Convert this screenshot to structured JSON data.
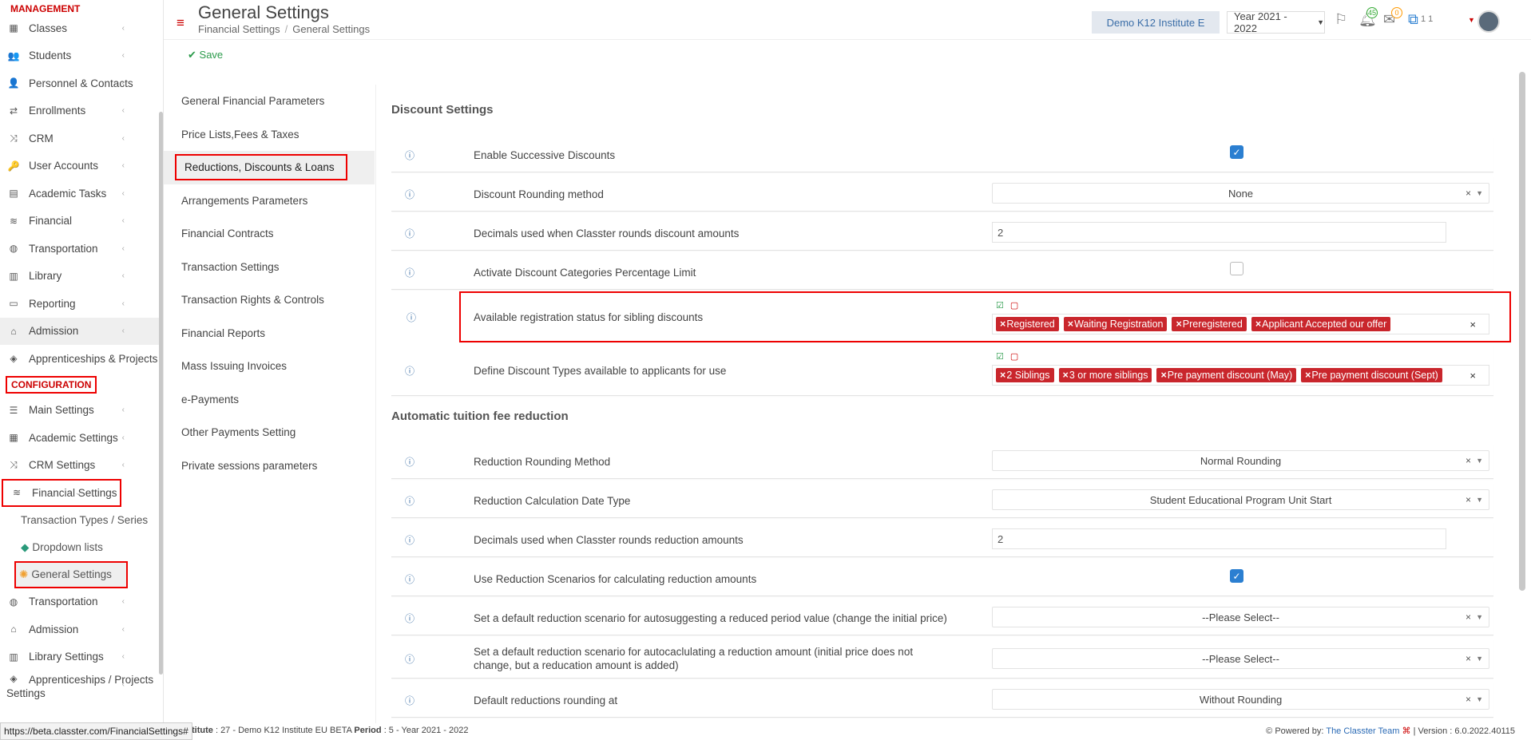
{
  "sidebar": {
    "management_title": "MANAGEMENT",
    "management_items": [
      {
        "label": "Classes",
        "icon": "classes-icon",
        "glyph": "▦"
      },
      {
        "label": "Students",
        "icon": "students-icon",
        "glyph": "👥"
      },
      {
        "label": "Personnel & Contacts",
        "icon": "personnel-icon",
        "glyph": "👤"
      },
      {
        "label": "Enrollments",
        "icon": "enrollments-icon",
        "glyph": "⇄"
      },
      {
        "label": "CRM",
        "icon": "crm-icon",
        "glyph": "⤨"
      },
      {
        "label": "User Accounts",
        "icon": "key-icon",
        "glyph": "🔑"
      },
      {
        "label": "Academic Tasks",
        "icon": "tasks-icon",
        "glyph": "▤"
      },
      {
        "label": "Financial",
        "icon": "coins-icon",
        "glyph": "≋"
      },
      {
        "label": "Transportation",
        "icon": "bus-icon",
        "glyph": "◍"
      },
      {
        "label": "Library",
        "icon": "library-icon",
        "glyph": "▥"
      },
      {
        "label": "Reporting",
        "icon": "print-icon",
        "glyph": "▭"
      },
      {
        "label": "Admission",
        "icon": "institution-icon",
        "glyph": "⌂"
      },
      {
        "label": "Apprenticeships & Projects",
        "icon": "cube-icon",
        "glyph": "◈"
      }
    ],
    "configuration_title": "CONFIGURATION",
    "configuration_items": [
      {
        "label": "Main Settings",
        "icon": "sliders-icon",
        "glyph": "☰"
      },
      {
        "label": "Academic Settings",
        "icon": "classes-icon",
        "glyph": "▦"
      },
      {
        "label": "CRM Settings",
        "icon": "crm-icon",
        "glyph": "⤨"
      },
      {
        "label": "Financial Settings",
        "icon": "coins-icon",
        "glyph": "≋"
      }
    ],
    "financial_sub_items": [
      {
        "label": "Transaction Types / Series"
      },
      {
        "label": "Dropdown lists",
        "glyph": "◆"
      },
      {
        "label": "General Settings",
        "glyph": "✺"
      }
    ],
    "more_items": [
      {
        "label": "Transportation",
        "icon": "bus-icon",
        "glyph": "◍"
      },
      {
        "label": "Admission",
        "icon": "institution-icon",
        "glyph": "⌂"
      },
      {
        "label": "Library Settings",
        "icon": "library-icon",
        "glyph": "▥"
      }
    ],
    "last_item_line1": "Apprenticeships / Projects",
    "last_item_line2": "Settings"
  },
  "header": {
    "page_title": "General Settings",
    "breadcrumb_parent": "Financial Settings",
    "breadcrumb_current": "General Settings",
    "institute": "Demo K12 Institute E",
    "year": "Year 2021 - 2022",
    "notifications_count": "45",
    "messages_count": "0",
    "user_text": "1 1"
  },
  "actions": {
    "save_label": "Save"
  },
  "settings_nav": [
    "General Financial Parameters",
    "Price Lists,Fees & Taxes",
    "Reductions, Discounts & Loans",
    "Arrangements Parameters",
    "Financial Contracts",
    "Transaction Settings",
    "Transaction Rights & Controls",
    "Financial Reports",
    "Mass Issuing Invoices",
    "e-Payments",
    "Other Payments Setting",
    "Private sessions parameters"
  ],
  "discount_section": {
    "title": "Discount Settings",
    "enable_successive": {
      "label": "Enable Successive Discounts",
      "checked": true
    },
    "rounding_method": {
      "label": "Discount Rounding method",
      "value": "None"
    },
    "decimals": {
      "label": "Decimals used when Classter rounds discount amounts",
      "value": "2"
    },
    "categories_limit": {
      "label": "Activate Discount Categories Percentage Limit",
      "checked": false
    },
    "sibling_status": {
      "label": "Available registration status for sibling discounts",
      "tags": [
        "Registered",
        "Waiting Registration",
        "Preregistered",
        "Applicant Accepted our offer"
      ]
    },
    "discount_types": {
      "label": "Define Discount Types available to applicants for use",
      "tags": [
        "2 Siblings",
        "3 or more siblings",
        "Pre payment discount (May)",
        "Pre payment discount (Sept)"
      ]
    }
  },
  "reduction_section": {
    "title": "Automatic tuition fee reduction",
    "rounding_method": {
      "label": "Reduction Rounding Method",
      "value": "Normal Rounding"
    },
    "date_type": {
      "label": "Reduction Calculation Date Type",
      "value": "Student Educational Program Unit Start"
    },
    "decimals": {
      "label": "Decimals used when Classter rounds reduction amounts",
      "value": "2"
    },
    "use_scenarios": {
      "label": "Use Reduction Scenarios for calculating reduction amounts",
      "checked": true
    },
    "default_period": {
      "label": "Set a default reduction scenario for autosuggesting a reduced period value (change the initial price)",
      "value": "--Please Select--"
    },
    "default_amount": {
      "label": "Set a default reduction scenario for autocaclulating a reduction amount (initial price does not change, but a reducation amount is added)",
      "value": "--Please Select--"
    },
    "rounding_at": {
      "label": "Default reductions rounding at",
      "value": "Without Rounding"
    }
  },
  "footer": {
    "status_url": "https://beta.classter.com/FinancialSettings#",
    "institute_label": "titute",
    "institute_value": ": 27 - Demo K12 Institute EU BETA",
    "period_label": "Period",
    "period_value": ": 5 - Year 2021 - 2022",
    "powered_by": "Powered by:",
    "team": "The Classter Team",
    "version": "| Version : 6.0.2022.40115"
  }
}
